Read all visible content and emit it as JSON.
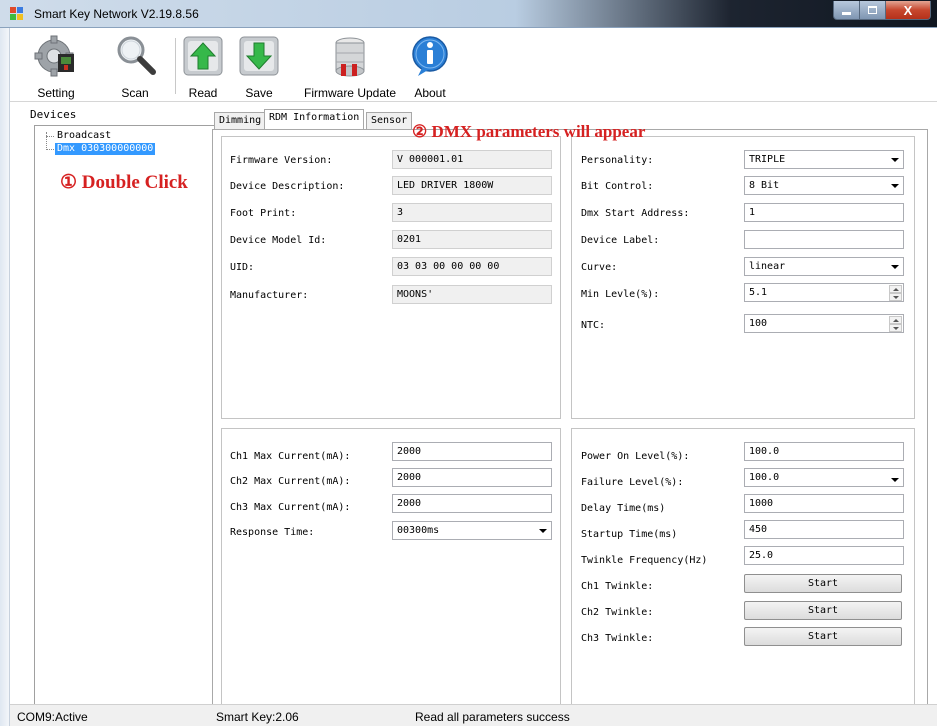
{
  "window": {
    "title": "Smart Key Network V2.19.8.56",
    "controls": {
      "minimize": "",
      "maximize": "",
      "close": "X"
    }
  },
  "toolbar": [
    {
      "id": "setting",
      "label": "Setting",
      "icon": "gear-icon"
    },
    {
      "id": "scan",
      "label": "Scan",
      "icon": "magnifier-icon"
    },
    {
      "id": "read",
      "label": "Read",
      "icon": "read-arrow-up-icon"
    },
    {
      "id": "save",
      "label": "Save",
      "icon": "save-arrow-down-icon"
    },
    {
      "id": "firmware",
      "label": "Firmware Update",
      "icon": "database-icon"
    },
    {
      "id": "about",
      "label": "About",
      "icon": "info-icon"
    }
  ],
  "devices": {
    "caption": "Devices",
    "items": [
      {
        "label": "Broadcast",
        "selected": false
      },
      {
        "label": "Dmx 030300000000",
        "selected": true
      }
    ],
    "annotation": "① Double Click"
  },
  "tabs": [
    {
      "label": "Dimming",
      "active": false
    },
    {
      "label": "RDM Information",
      "active": true
    },
    {
      "label": "Sensor",
      "active": false
    }
  ],
  "tab_annotation": "② DMX parameters will appear",
  "rdm_info": {
    "firmware_version": {
      "label": "Firmware Version:",
      "value": "V 000001.01"
    },
    "device_description": {
      "label": "Device Description:",
      "value": "LED DRIVER 1800W"
    },
    "foot_print": {
      "label": "Foot Print:",
      "value": "3"
    },
    "device_model_id": {
      "label": "Device Model Id:",
      "value": "0201"
    },
    "uid": {
      "label": "UID:",
      "value": "03 03 00 00 00 00"
    },
    "manufacturer": {
      "label": "Manufacturer:",
      "value": "MOONS'"
    }
  },
  "dmx_params": {
    "personality": {
      "label": "Personality:",
      "value": "TRIPLE"
    },
    "bit_control": {
      "label": "Bit Control:",
      "value": "8 Bit"
    },
    "dmx_start_address": {
      "label": "Dmx Start Address:",
      "value": "1"
    },
    "device_label": {
      "label": "Device Label:",
      "value": ""
    },
    "curve": {
      "label": "Curve:",
      "value": "linear"
    },
    "min_level": {
      "label": "Min Levle(%):",
      "value": "5.1"
    },
    "ntc": {
      "label": "NTC:",
      "value": "100"
    }
  },
  "channel_current": {
    "ch1": {
      "label": "Ch1 Max Current(mA):",
      "value": "2000"
    },
    "ch2": {
      "label": "Ch2 Max Current(mA):",
      "value": "2000"
    },
    "ch3": {
      "label": "Ch3 Max Current(mA):",
      "value": "2000"
    },
    "response_time": {
      "label": "Response Time:",
      "value": "00300ms"
    }
  },
  "power_settings": {
    "power_on_level": {
      "label": "Power On Level(%):",
      "value": "100.0"
    },
    "failure_level": {
      "label": "Failure Level(%):",
      "value": "100.0"
    },
    "delay_time": {
      "label": "Delay Time(ms)",
      "value": "1000"
    },
    "startup_time": {
      "label": "Startup Time(ms)",
      "value": "450"
    },
    "twinkle_frequency": {
      "label": "Twinkle Frequency(Hz)",
      "value": "25.0"
    },
    "ch1_twinkle": {
      "label": "Ch1 Twinkle:",
      "button": "Start"
    },
    "ch2_twinkle": {
      "label": "Ch2 Twinkle:",
      "button": "Start"
    },
    "ch3_twinkle": {
      "label": "Ch3 Twinkle:",
      "button": "Start"
    }
  },
  "status": {
    "port": "COM9:Active",
    "smart_key": "Smart Key:2.06",
    "message": "Read all parameters success"
  },
  "colors": {
    "annotation_red": "#d62121",
    "selection_blue": "#3399ff",
    "close_red": "#c7472e"
  }
}
